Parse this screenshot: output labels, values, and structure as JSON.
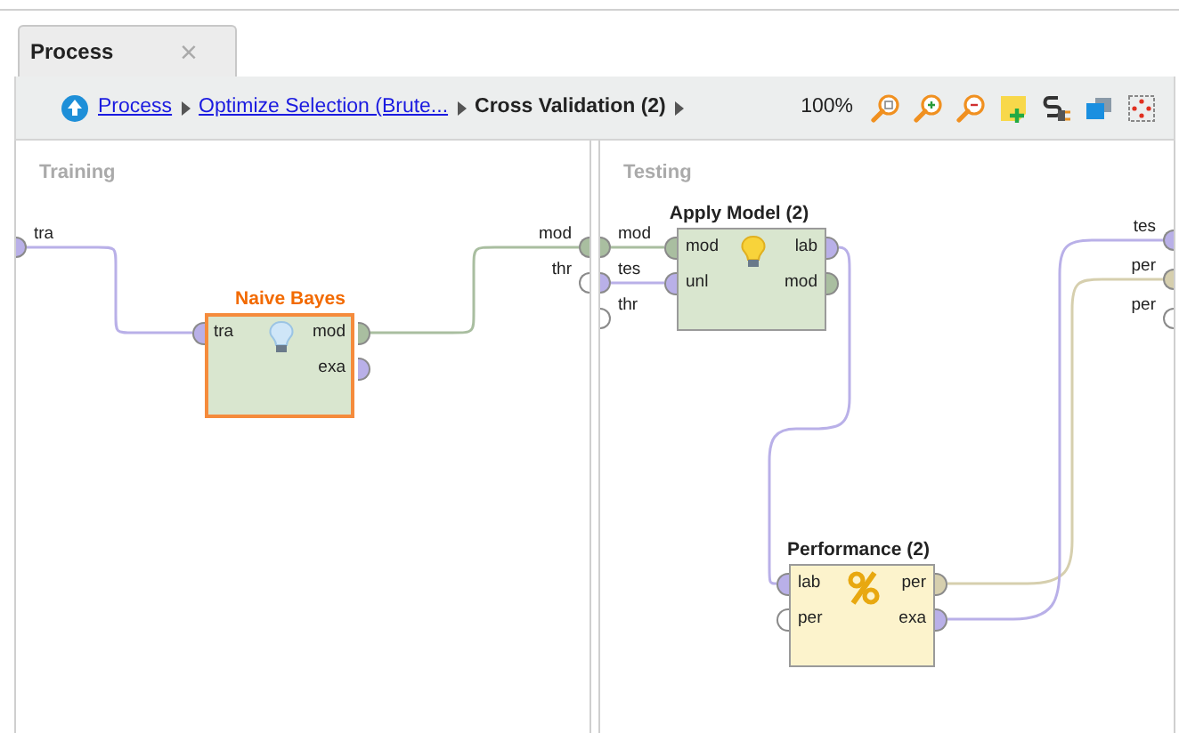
{
  "tabs": [
    {
      "label": "Process",
      "close": "×",
      "selected": true
    }
  ],
  "breadcrumb": [
    {
      "label": "Process",
      "link": true
    },
    {
      "label": "Optimize Selection (Brute...",
      "link": true
    },
    {
      "label": "Cross Validation (2)",
      "link": false
    }
  ],
  "zoom": "100%",
  "panels": [
    {
      "title": "Training",
      "inputs": [
        {
          "label": "tra",
          "color": "#b9b0e8"
        }
      ],
      "outputs": [
        {
          "label": "mod",
          "color": "#a9bea0"
        },
        {
          "label": "thr",
          "color": "#ffffff"
        }
      ],
      "operators": [
        {
          "name": "Naive Bayes",
          "kind": "learner",
          "selected": true,
          "inputs": [
            {
              "label": "tra",
              "color": "#b9b0e8"
            }
          ],
          "outputs": [
            {
              "label": "mod",
              "color": "#a9bea0"
            },
            {
              "label": "exa",
              "color": "#b9b0e8"
            }
          ]
        }
      ]
    },
    {
      "title": "Testing",
      "inputs": [
        {
          "label": "mod",
          "color": "#a9bea0"
        },
        {
          "label": "tes",
          "color": "#b9b0e8"
        },
        {
          "label": "thr",
          "color": "#ffffff"
        }
      ],
      "outputs": [
        {
          "label": "tes",
          "color": "#b9b0e8"
        },
        {
          "label": "per",
          "color": "#d6cfae"
        },
        {
          "label": "per",
          "color": "#ffffff"
        }
      ],
      "operators": [
        {
          "name": "Apply Model (2)",
          "kind": "applier",
          "selected": false,
          "inputs": [
            {
              "label": "mod",
              "color": "#a9bea0"
            },
            {
              "label": "unl",
              "color": "#b9b0e8"
            }
          ],
          "outputs": [
            {
              "label": "lab",
              "color": "#b9b0e8"
            },
            {
              "label": "mod",
              "color": "#a9bea0"
            }
          ]
        },
        {
          "name": "Performance (2)",
          "kind": "evaluator",
          "selected": false,
          "inputs": [
            {
              "label": "lab",
              "color": "#b9b0e8"
            },
            {
              "label": "per",
              "color": "#ffffff"
            }
          ],
          "outputs": [
            {
              "label": "per",
              "color": "#d6cfae"
            },
            {
              "label": "exa",
              "color": "#b9b0e8"
            }
          ]
        }
      ]
    }
  ]
}
